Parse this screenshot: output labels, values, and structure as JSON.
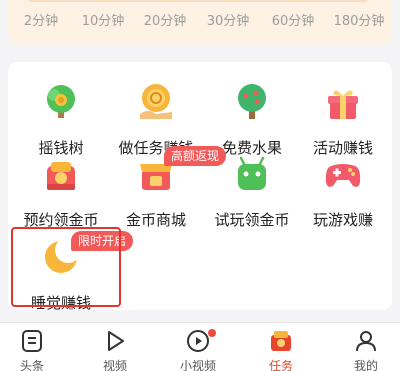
{
  "time_selector": {
    "labels": [
      "2分钟",
      "10分钟",
      "20分钟",
      "30分钟",
      "60分钟",
      "180分钟"
    ]
  },
  "tasks": [
    {
      "label": "摇钱树",
      "icon": "money-tree-icon"
    },
    {
      "label": "做任务赚钱",
      "icon": "coin-hand-icon"
    },
    {
      "label": "免费水果",
      "icon": "fruit-tree-icon"
    },
    {
      "label": "活动赚钱",
      "icon": "gift-box-icon"
    },
    {
      "label": "预约领金币",
      "icon": "coin-box-icon"
    },
    {
      "label": "金币商城",
      "icon": "shop-icon",
      "badge": "高额返现"
    },
    {
      "label": "试玩领金币",
      "icon": "android-icon"
    },
    {
      "label": "玩游戏赚",
      "icon": "gamepad-icon"
    },
    {
      "label": "睡觉赚钱",
      "icon": "moon-icon",
      "badge": "限时开启"
    }
  ],
  "tabbar": [
    {
      "label": "头条",
      "icon": "headline-icon",
      "active": false
    },
    {
      "label": "视频",
      "icon": "play-icon",
      "active": false
    },
    {
      "label": "小视频",
      "icon": "short-video-icon",
      "active": false,
      "dot": true
    },
    {
      "label": "任务",
      "icon": "task-icon",
      "active": true
    },
    {
      "label": "我的",
      "icon": "profile-icon",
      "active": false
    }
  ],
  "colors": {
    "accent": "#e8452f",
    "badge": "#f25a5a",
    "highlight": "#e3342f"
  }
}
